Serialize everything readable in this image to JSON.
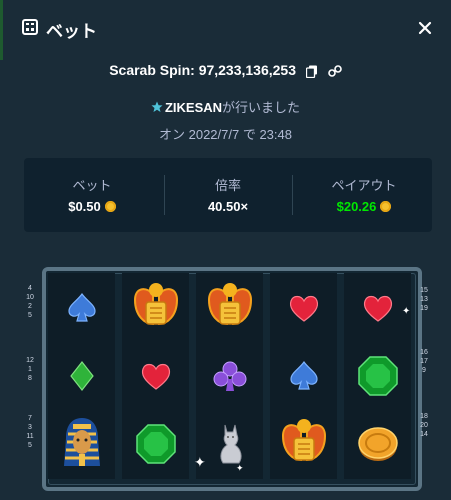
{
  "header": {
    "title": "ベット",
    "title_icon": "slots-icon",
    "close_icon": "close-icon"
  },
  "bet": {
    "game_label": "Scarab Spin:",
    "bet_id": "97,233,136,253",
    "user_prefix_icon": "star-badge-icon",
    "username": "ZIKESAN",
    "user_suffix": "が行いました",
    "date_line": "オン 2022/7/7 で 23:48"
  },
  "stats": {
    "bet_label": "ベット",
    "bet_value": "$0.50",
    "multiplier_label": "倍率",
    "multiplier_value": "40.50×",
    "payout_label": "ペイアウト",
    "payout_value": "$20.26"
  },
  "reels": {
    "symbols": [
      [
        "spade-blue",
        "diamond-green",
        "pharaoh"
      ],
      [
        "scarab",
        "heart-red",
        "emerald"
      ],
      [
        "scarab",
        "club-purple",
        "cat-statue"
      ],
      [
        "heart-red",
        "spade-blue",
        "scarab"
      ],
      [
        "heart-red",
        "emerald",
        "gold-coin"
      ]
    ],
    "left_numbers": [
      [
        "4",
        "10",
        "2",
        "5"
      ],
      [
        "12",
        "1",
        "8"
      ],
      [
        "7",
        "3",
        "11",
        "5"
      ]
    ],
    "right_numbers": [
      [
        "15",
        "13",
        "19"
      ],
      [
        "16",
        "17",
        "9"
      ],
      [
        "18",
        "20",
        "14"
      ]
    ]
  },
  "colors": {
    "background": "#1a2c38",
    "panel": "#0f212e",
    "payout_green": "#00e701"
  }
}
